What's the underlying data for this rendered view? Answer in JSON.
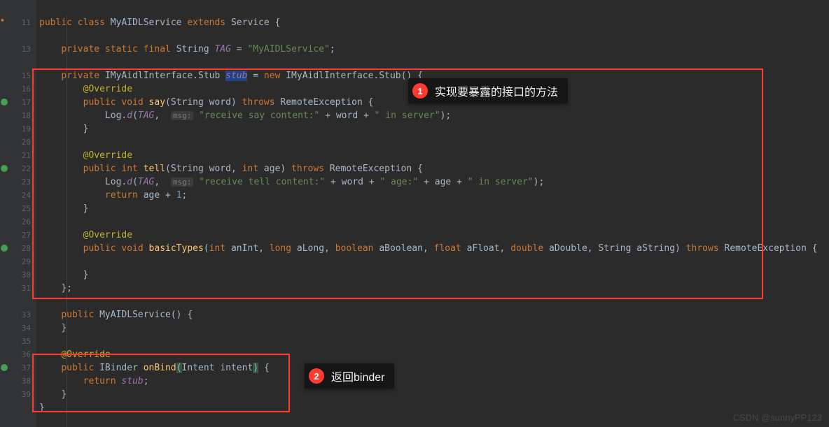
{
  "gutter": {
    "line_numbers": [
      "",
      "11",
      "",
      "13",
      "",
      "15",
      "16",
      "17",
      "18",
      "19",
      "20",
      "21",
      "22",
      "23",
      "24",
      "25",
      "26",
      "27",
      "28",
      "29",
      "30",
      "31",
      "",
      "33",
      "34",
      "35",
      "36",
      "37",
      "38",
      "39",
      ""
    ]
  },
  "code": {
    "l11_public": "public ",
    "l11_class": "class ",
    "l11_name": "MyAIDLService ",
    "l11_extends": "extends ",
    "l11_parent": "Service ",
    "l11_brace": "{",
    "l13_priv": "private static final ",
    "l13_type": "String ",
    "l13_tag": "TAG ",
    "l13_eq": "= ",
    "l13_val": "\"MyAIDLService\"",
    "l13_semi": ";",
    "l15_priv": "private ",
    "l15_type": "IMyAidlInterface.Stub ",
    "l15_var": "stub",
    "l15_eq": " = ",
    "l15_new": "new ",
    "l15_ctor": "IMyAidlInterface.Stub() {",
    "l16_ann": "@Override",
    "l17_pub": "public void ",
    "l17_mth": "say",
    "l17_sig": "(String word) ",
    "l17_throws": "throws ",
    "l17_exc": "RemoteException {",
    "l18_call": "Log.",
    "l18_m": "d",
    "l18_open": "(",
    "l18_tag": "TAG",
    "l18_c1": ",  ",
    "l18_hint": "msg:",
    "l18_s1": " \"receive say content:\" ",
    "l18_plus": "+ word + ",
    "l18_s2": "\" in server\"",
    "l18_close": ");",
    "l19_cb": "}",
    "l21_ann": "@Override",
    "l22_pub": "public int ",
    "l22_mth": "tell",
    "l22_sig": "(String word, ",
    "l22_int": "int ",
    "l22_age": "age) ",
    "l22_throws": "throws ",
    "l22_exc": "RemoteException {",
    "l23_call": "Log.",
    "l23_m": "d",
    "l23_open": "(",
    "l23_tag": "TAG",
    "l23_c1": ",  ",
    "l23_hint": "msg:",
    "l23_s1": " \"receive tell content:\" ",
    "l23_p1": "+ word + ",
    "l23_s2": "\" age:\" ",
    "l23_p2": "+ age + ",
    "l23_s3": "\" in server\"",
    "l23_close": ");",
    "l24_ret": "return ",
    "l24_expr": "age + ",
    "l24_num": "1",
    "l24_semi": ";",
    "l25_cb": "}",
    "l27_ann": "@Override",
    "l28_pub": "public void ",
    "l28_mth": "basicTypes",
    "l28_open": "(",
    "l28_int": "int ",
    "l28_p1": "anInt, ",
    "l28_long": "long ",
    "l28_p2": "aLong, ",
    "l28_bool": "boolean ",
    "l28_p3": "aBoolean, ",
    "l28_float": "float ",
    "l28_p4": "aFloat, ",
    "l28_double": "double ",
    "l28_p5": "aDouble, ",
    "l28_str": "String ",
    "l28_p6": "aString) ",
    "l28_throws": "throws ",
    "l28_exc": "RemoteException {",
    "l30_cb": "}",
    "l31_cb": "};",
    "l33_pub": "public ",
    "l33_ctor": "MyAIDLService",
    "l33_sig": "() {",
    "l34_cb": "}",
    "l36_ann": "@Override",
    "l37_pub": "public ",
    "l37_type": "IBinder ",
    "l37_mth": "onBind",
    "l37_open": "(",
    "l37_ptype": "Intent ",
    "l37_pname": "intent",
    "l37_close": ")",
    "l37_brace": " {",
    "l38_ret": "return ",
    "l38_val": "stub",
    "l38_semi": ";",
    "l39_cb": "}",
    "l40_cb": "}"
  },
  "callouts": {
    "c1_num": "1",
    "c1_text": "实现要暴露的接口的方法",
    "c2_num": "2",
    "c2_text": "返回binder"
  },
  "watermark": "CSDN @sunnyPP123"
}
